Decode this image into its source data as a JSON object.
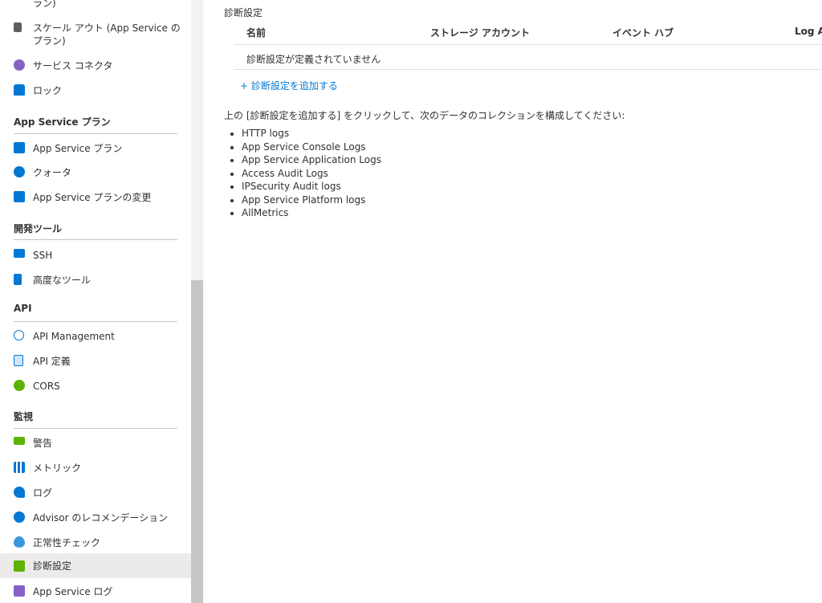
{
  "sidebar": {
    "items": [
      {
        "label": "ラン)",
        "icon": "none"
      },
      {
        "label": "スケール アウト (App Service の",
        "label2": "プラン)",
        "icon": "scale-out-icon",
        "color": "#605e5c"
      },
      {
        "label": "サービス コネクタ",
        "icon": "service-connector-icon",
        "color": "#8661c5"
      },
      {
        "label": "ロック",
        "icon": "lock-icon",
        "color": "#0078d4"
      }
    ],
    "section_app_service_plan": "App Service プラン",
    "items_plan": [
      {
        "label": "App Service プラン",
        "icon": "app-service-plan-icon",
        "color": "#0078d4"
      },
      {
        "label": "クォータ",
        "icon": "quota-icon",
        "color": "#0078d4"
      },
      {
        "label": "App Service プランの変更",
        "icon": "change-plan-icon",
        "color": "#0078d4"
      }
    ],
    "section_dev_tools": "開発ツール",
    "items_dev": [
      {
        "label": "SSH",
        "icon": "ssh-icon",
        "color": "#0078d4"
      },
      {
        "label": "高度なツール",
        "icon": "advanced-tools-icon",
        "color": "#0078d4"
      }
    ],
    "section_api": "API",
    "items_api": [
      {
        "label": "API Management",
        "icon": "api-management-icon",
        "color": "#0078d4"
      },
      {
        "label": "API 定義",
        "icon": "api-definition-icon",
        "color": "#0078d4"
      },
      {
        "label": "CORS",
        "icon": "cors-icon",
        "color": "#5db300"
      }
    ],
    "section_monitoring": "監視",
    "items_monitor": [
      {
        "label": "警告",
        "icon": "alerts-icon",
        "color": "#5db300"
      },
      {
        "label": "メトリック",
        "icon": "metrics-icon",
        "color": "#0078d4"
      },
      {
        "label": "ログ",
        "icon": "logs-icon",
        "color": "#0078d4"
      },
      {
        "label": "Advisor のレコメンデーション",
        "icon": "advisor-icon",
        "color": "#0078d4"
      },
      {
        "label": "正常性チェック",
        "icon": "health-check-icon",
        "color": "#0078d4"
      },
      {
        "label": "診断設定",
        "icon": "diagnostic-settings-icon",
        "color": "#5db300",
        "selected": true
      },
      {
        "label": "App Service ログ",
        "icon": "app-service-logs-icon",
        "color": "#8661c5"
      }
    ]
  },
  "main": {
    "section_title": "診断設定",
    "table": {
      "headers": [
        "名前",
        "ストレージ アカウント",
        "イベント ハブ",
        "Log A"
      ],
      "empty_text": "診断設定が定義されていません"
    },
    "add_link": "+ 診断設定を追加する",
    "instruction": "上の [診断設定を追加する] をクリックして、次のデータのコレクションを構成してください:",
    "log_categories": [
      "HTTP logs",
      "App Service Console Logs",
      "App Service Application Logs",
      "Access Audit Logs",
      "IPSecurity Audit logs",
      "App Service Platform logs",
      "AllMetrics"
    ]
  }
}
